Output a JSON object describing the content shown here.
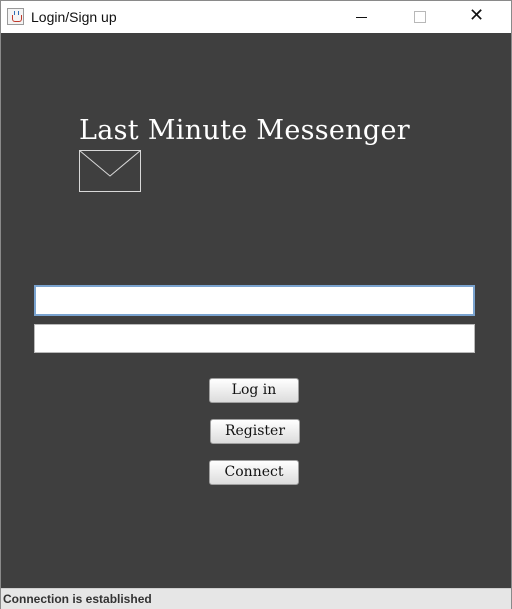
{
  "window": {
    "title": "Login/Sign up",
    "icon": "java-cup-icon"
  },
  "header": {
    "app_name": "Last Minute Messenger",
    "logo_icon": "envelope-icon"
  },
  "form": {
    "username_value": "",
    "password_value": "",
    "login_label": "Log in",
    "register_label": "Register",
    "connect_label": "Connect"
  },
  "status": {
    "text": "Connection is established"
  },
  "colors": {
    "background": "#3f3f3f",
    "focus_border": "#7aa3cf",
    "text_light": "#ffffff"
  }
}
